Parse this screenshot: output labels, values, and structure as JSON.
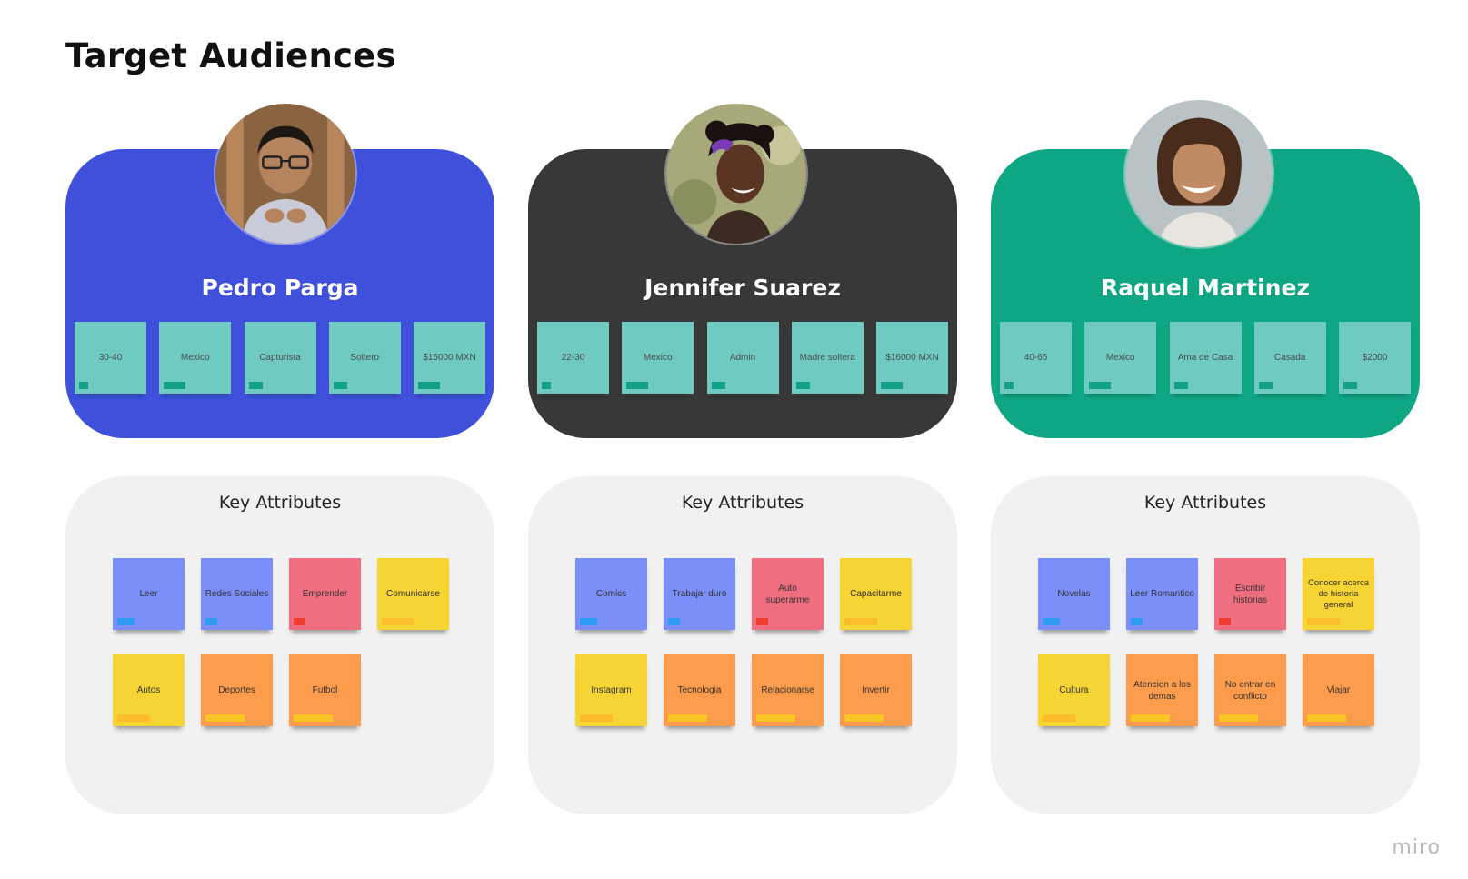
{
  "board": {
    "title": "Target Audiences",
    "brand": "miro"
  },
  "personas": [
    {
      "name": "Pedro Parga",
      "color": "#3f51db",
      "tags": [
        "30-40",
        "Mexico",
        "Capturista",
        "Soltero",
        "$15000 MXN"
      ],
      "attributes_title": "Key Attributes",
      "attributes": [
        {
          "text": "Leer",
          "color": "blue"
        },
        {
          "text": "Redes Sociales",
          "color": "blue"
        },
        {
          "text": "Emprender",
          "color": "red"
        },
        {
          "text": "Comunicarse",
          "color": "yellow"
        },
        {
          "text": "Autos",
          "color": "yellow"
        },
        {
          "text": "Deportes",
          "color": "orange"
        },
        {
          "text": "Futbol",
          "color": "orange"
        }
      ]
    },
    {
      "name": "Jennifer Suarez",
      "color": "#383838",
      "tags": [
        "22-30",
        "Mexico",
        "Admin",
        "Madre soltera",
        "$16000 MXN"
      ],
      "attributes_title": "Key Attributes",
      "attributes": [
        {
          "text": "Comics",
          "color": "blue"
        },
        {
          "text": "Trabajar duro",
          "color": "blue"
        },
        {
          "text": "Auto superarme",
          "color": "red"
        },
        {
          "text": "Capacitarme",
          "color": "yellow"
        },
        {
          "text": "Instagram",
          "color": "yellow"
        },
        {
          "text": "Tecnologia",
          "color": "orange"
        },
        {
          "text": "Relacionarse",
          "color": "orange"
        },
        {
          "text": "Invertir",
          "color": "orange"
        }
      ]
    },
    {
      "name": "Raquel Martinez",
      "color": "#0fa684",
      "tags": [
        "40-65",
        "Mexico",
        "Ama de Casa",
        "Casada",
        "$2000"
      ],
      "attributes_title": "Key Attributes",
      "attributes": [
        {
          "text": "Novelas",
          "color": "blue"
        },
        {
          "text": "Leer Romantico",
          "color": "blue"
        },
        {
          "text": "Escribir historias",
          "color": "red"
        },
        {
          "text": "Conocer acerca de historia general",
          "color": "yellow"
        },
        {
          "text": "Cultura",
          "color": "yellow"
        },
        {
          "text": "Atencion a los demas",
          "color": "orange"
        },
        {
          "text": "No entrar en conflicto",
          "color": "orange"
        },
        {
          "text": "Viajar",
          "color": "orange"
        }
      ]
    }
  ]
}
